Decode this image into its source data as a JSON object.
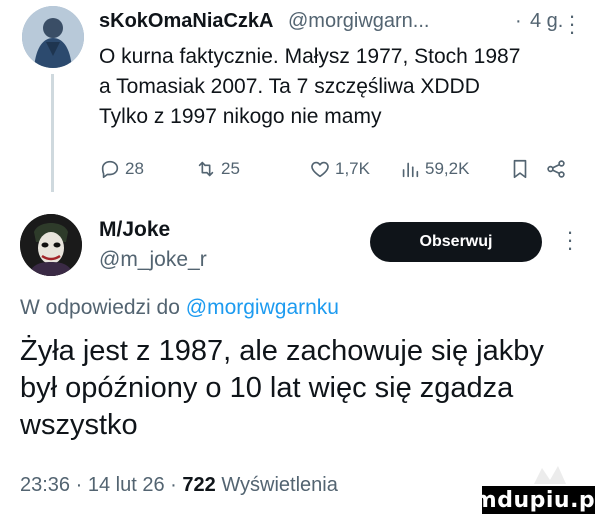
{
  "tweet1": {
    "display_name": "sKokOmaNiaCzkA",
    "handle": "@morgiwgarn...",
    "separator": "·",
    "time_ago": "4 g.",
    "text": "O kurna faktycznie. Małysz 1977, Stoch 1987\na Tomasiak 2007. Ta 7 szczęśliwa XDDD\nTylko z 1997 nikogo nie mamy",
    "actions": {
      "replies": "28",
      "retweets": "25",
      "likes": "1,7K",
      "views": "59,2K"
    }
  },
  "tweet2": {
    "display_name": "M/Joke",
    "handle": "@m_joke_r",
    "follow_label": "Obserwuj",
    "reply_prefix": "W odpowiedzi do",
    "reply_mention": "@morgiwgarnku",
    "text": "Żyła jest z 1987, ale zachowuje się jakby był opóźniony o 10 lat więc się zgadza wszystko",
    "meta": {
      "time": "23:36",
      "sep": "·",
      "date": "14 lut 26",
      "views_count": "722",
      "views_label": "Wyświetlenia"
    }
  },
  "watermark": {
    "text": "mdupiu.pl"
  },
  "colors": {
    "text": "#0f1419",
    "muted": "#536471",
    "link": "#1d9bf0",
    "button": "#0f1419"
  }
}
